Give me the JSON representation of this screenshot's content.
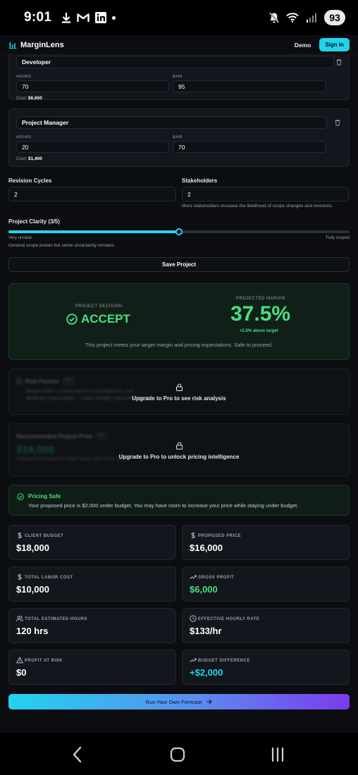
{
  "status_bar": {
    "time": "9:01",
    "battery": "93"
  },
  "header": {
    "brand": "MarginLens",
    "demo_label": "Demo",
    "signin_label": "Sign In"
  },
  "team": [
    {
      "role": "Developer",
      "hours_label": "HOURS",
      "hours": "70",
      "rate_label": "$/HR",
      "rate": "95",
      "cost_label": "Cost:",
      "cost": "$6,650"
    },
    {
      "role": "Project Manager",
      "hours_label": "HOURS",
      "hours": "20",
      "rate_label": "$/HR",
      "rate": "70",
      "cost_label": "Cost:",
      "cost": "$1,400"
    }
  ],
  "revision": {
    "label": "Revision Cycles",
    "value": "2"
  },
  "stakeholders": {
    "label": "Stakeholders",
    "value": "2",
    "hint": "More stakeholders increase the likelihood of scope changes and revisions."
  },
  "clarity": {
    "label": "Project Clarity (3/5)",
    "min_label": "Very unclear",
    "max_label": "Fully scoped",
    "description": "General scope known but some uncertainty remains",
    "level": 0.5
  },
  "save_label": "Save Project",
  "decision": {
    "decision_title": "PROJECT DECISION",
    "decision": "ACCEPT",
    "margin_title": "PROJECTED MARGIN",
    "margin": "37.5%",
    "margin_delta": "+2.5% above target",
    "message": "This project meets your target margin and pricing expectations. Safe to proceed."
  },
  "risk": {
    "title": "Risk Factors",
    "badge": "Pro",
    "items": [
      "Margin buffer is small relative to estimated labor cost",
      "Moderate project clarity — scope changes may erode margin"
    ],
    "upgrade": "Upgrade to Pro to see risk analysis"
  },
  "pricing": {
    "title": "Recommended Project Price",
    "badge": "Pro",
    "price": "$18,000",
    "note": "Calculated price based on target margin, labor costs, and risk",
    "upgrade": "Upgrade to Pro to unlock pricing intelligence"
  },
  "safe": {
    "title": "Pricing Safe",
    "message": "Your proposed price is $2,000 under budget. You may have room to increase your price while staying under budget."
  },
  "metrics": [
    {
      "label": "CLIENT BUDGET",
      "value": "$18,000",
      "icon": "dollar-icon"
    },
    {
      "label": "PROPOSED PRICE",
      "value": "$16,000",
      "icon": "dollar-icon"
    },
    {
      "label": "TOTAL LABOR COST",
      "value": "$10,000",
      "icon": "dollar-icon"
    },
    {
      "label": "GROSS PROFIT",
      "value": "$6,000",
      "icon": "trend-up-icon"
    },
    {
      "label": "TOTAL ESTIMATED HOURS",
      "value": "120 hrs",
      "icon": "users-icon"
    },
    {
      "label": "EFFECTIVE HOURLY RATE",
      "value": "$133/hr",
      "icon": "clock-icon"
    },
    {
      "label": "PROFIT AT RISK",
      "value": "$0",
      "icon": "warning-icon"
    },
    {
      "label": "BUDGET DIFFERENCE",
      "value": "+$2,000",
      "icon": "trend-up-icon"
    }
  ],
  "colors": {
    "accent": "#22d3ee",
    "success": "#4ade80",
    "teal": "#22d3ee",
    "purple": "#7c3aed"
  },
  "cta_label": "Run Your Own Forecast"
}
